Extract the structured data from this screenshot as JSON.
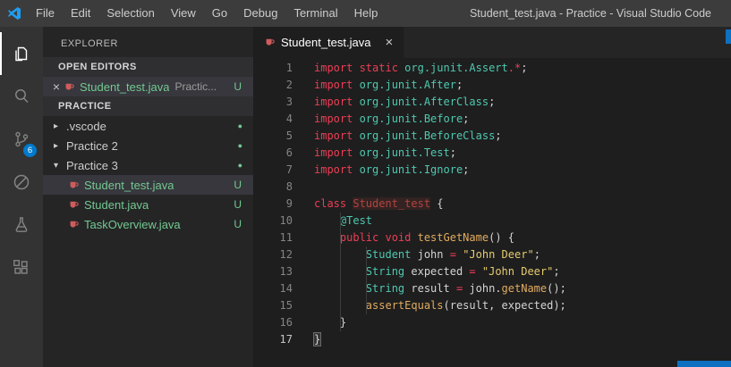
{
  "title_bar": {
    "logo_icon": "vscode-logo-icon",
    "menus": [
      "File",
      "Edit",
      "Selection",
      "View",
      "Go",
      "Debug",
      "Terminal",
      "Help"
    ],
    "title": "Student_test.java - Practice - Visual Studio Code"
  },
  "activity_bar": {
    "items": [
      {
        "id": "explorer",
        "icon": "files-icon",
        "active": true
      },
      {
        "id": "search",
        "icon": "search-icon",
        "active": false
      },
      {
        "id": "source-control",
        "icon": "source-control-icon",
        "active": false,
        "badge": "6"
      },
      {
        "id": "debug",
        "icon": "debug-icon",
        "active": false
      },
      {
        "id": "test",
        "icon": "flask-icon",
        "active": false
      },
      {
        "id": "extensions",
        "icon": "extensions-icon",
        "active": false
      }
    ]
  },
  "sidebar": {
    "header": "EXPLORER",
    "sections": [
      {
        "label": "OPEN EDITORS"
      },
      {
        "label": "PRACTICE"
      }
    ],
    "open_editors": [
      {
        "label": "Student_test.java",
        "description": "Practic...",
        "badge": "U",
        "selected": true,
        "icon": "java-file-icon",
        "close_icon": "close-icon"
      }
    ],
    "tree": [
      {
        "label": ".vscode",
        "kind": "folder",
        "expanded": false,
        "indicator": "dot",
        "indent": 0
      },
      {
        "label": "Practice 2",
        "kind": "folder",
        "expanded": false,
        "indicator": "dot",
        "indent": 0
      },
      {
        "label": "Practice 3",
        "kind": "folder",
        "expanded": true,
        "indicator": "dot",
        "indent": 0
      },
      {
        "label": "Student_test.java",
        "kind": "file",
        "badge": "U",
        "selected": true,
        "indent": 1,
        "icon": "java-file-icon"
      },
      {
        "label": "Student.java",
        "kind": "file",
        "badge": "U",
        "selected": false,
        "indent": 1,
        "icon": "java-file-icon"
      },
      {
        "label": "TaskOverview.java",
        "kind": "file",
        "badge": "U",
        "selected": false,
        "indent": 1,
        "icon": "java-file-icon"
      }
    ]
  },
  "editor": {
    "tabs": [
      {
        "label": "Student_test.java",
        "active": true,
        "icon": "java-file-icon",
        "close_icon": "close-icon"
      }
    ],
    "lines": [
      [
        [
          "k",
          "import static "
        ],
        [
          "t",
          "org.junit.Assert"
        ],
        [
          "k",
          ".*"
        ],
        [
          "d",
          ";"
        ]
      ],
      [
        [
          "k",
          "import "
        ],
        [
          "t",
          "org.junit.After"
        ],
        [
          "d",
          ";"
        ]
      ],
      [
        [
          "k",
          "import "
        ],
        [
          "t",
          "org.junit.AfterClass"
        ],
        [
          "d",
          ";"
        ]
      ],
      [
        [
          "k",
          "import "
        ],
        [
          "t",
          "org.junit.Before"
        ],
        [
          "d",
          ";"
        ]
      ],
      [
        [
          "k",
          "import "
        ],
        [
          "t",
          "org.junit.BeforeClass"
        ],
        [
          "d",
          ";"
        ]
      ],
      [
        [
          "k",
          "import "
        ],
        [
          "t",
          "org.junit.Test"
        ],
        [
          "d",
          ";"
        ]
      ],
      [
        [
          "k",
          "import "
        ],
        [
          "t",
          "org.junit.Ignore"
        ],
        [
          "d",
          ";"
        ]
      ],
      [],
      [
        [
          "k",
          "class "
        ],
        [
          "c",
          "Student_test"
        ],
        [
          "d",
          " {"
        ]
      ],
      [
        [
          "d",
          "    "
        ],
        [
          "a",
          "@Test"
        ]
      ],
      [
        [
          "d",
          "    "
        ],
        [
          "k",
          "public void "
        ],
        [
          "m",
          "testGetName"
        ],
        [
          "d",
          "() {"
        ]
      ],
      [
        [
          "d",
          "        "
        ],
        [
          "t",
          "Student"
        ],
        [
          "d",
          " john "
        ],
        [
          "k",
          "="
        ],
        [
          "d",
          " "
        ],
        [
          "s",
          "\"John Deer\""
        ],
        [
          "d",
          ";"
        ]
      ],
      [
        [
          "d",
          "        "
        ],
        [
          "t",
          "String"
        ],
        [
          "d",
          " expected "
        ],
        [
          "k",
          "="
        ],
        [
          "d",
          " "
        ],
        [
          "s",
          "\"John Deer\""
        ],
        [
          "d",
          ";"
        ]
      ],
      [
        [
          "d",
          "        "
        ],
        [
          "t",
          "String"
        ],
        [
          "d",
          " result "
        ],
        [
          "k",
          "="
        ],
        [
          "d",
          " john."
        ],
        [
          "m",
          "getName"
        ],
        [
          "d",
          "();"
        ]
      ],
      [
        [
          "d",
          "        "
        ],
        [
          "m",
          "assertEquals"
        ],
        [
          "d",
          "(result, expected);"
        ]
      ],
      [
        [
          "d",
          "    }"
        ]
      ],
      [
        [
          "b",
          "}"
        ]
      ]
    ]
  },
  "colors": {
    "accent": "#0e70c1",
    "badge": "#007acc",
    "untracked": "#73c991",
    "kw": "#ec3e55",
    "type": "#4ec9b0",
    "method": "#e2ab5f",
    "string": "#e6cb6f",
    "classname": "#b5443f",
    "text": "#d4d4d4",
    "javaicon": "#cf5c5c",
    "linenumber": "#858585"
  }
}
